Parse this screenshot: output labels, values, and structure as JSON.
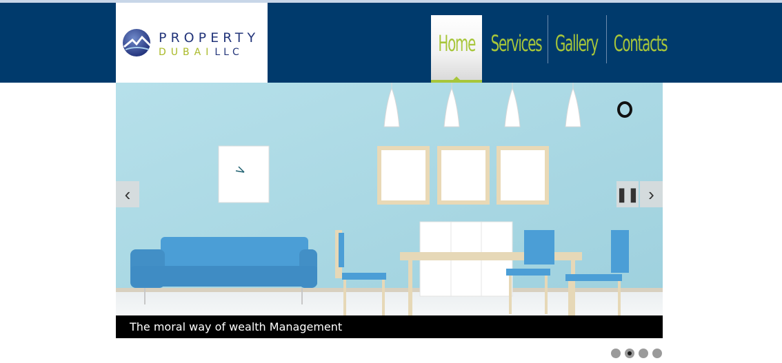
{
  "brand": {
    "name_line1": "PROPERTY",
    "name_line2": "DUBAI",
    "name_suffix": "LLC"
  },
  "nav": {
    "items": [
      {
        "label": "Home",
        "active": true
      },
      {
        "label": "Services",
        "active": false
      },
      {
        "label": "Gallery",
        "active": false
      },
      {
        "label": "Contacts",
        "active": false
      }
    ]
  },
  "slider": {
    "caption": "The moral way of wealth Management",
    "prev_icon": "chevron-left-icon",
    "next_icon": "chevron-right-icon",
    "pause_icon": "pause-icon",
    "loading_icon": "spinner-icon",
    "slide_count": 4,
    "active_slide": 2
  },
  "colors": {
    "header_bg": "#003a6c",
    "nav_text": "#a7c63a",
    "logo_blue": "#23357a",
    "logo_green": "#a9b927",
    "wall": "#a9d8e4",
    "sofa": "#4b9ed6"
  }
}
